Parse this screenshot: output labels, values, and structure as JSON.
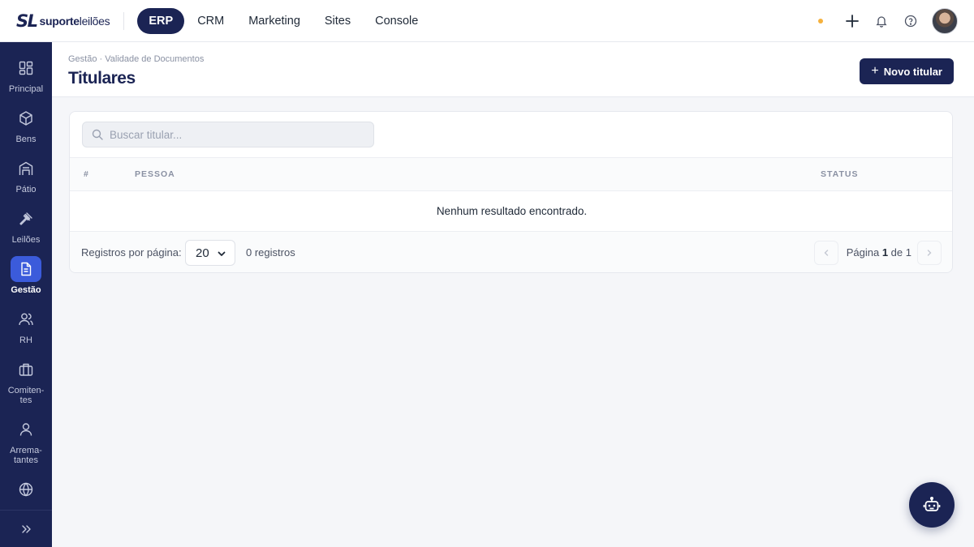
{
  "brand": {
    "mark": "SL",
    "name_bold": "suporte",
    "name_light": "leilões"
  },
  "nav": {
    "items": [
      {
        "label": "ERP",
        "active": true
      },
      {
        "label": "CRM",
        "active": false
      },
      {
        "label": "Marketing",
        "active": false
      },
      {
        "label": "Sites",
        "active": false
      },
      {
        "label": "Console",
        "active": false
      }
    ]
  },
  "top_actions": {
    "status_dot_color": "#f5b13d",
    "icons": [
      "plus-icon",
      "bell-icon",
      "help-icon"
    ]
  },
  "sidebar": {
    "items": [
      {
        "label": "Principal",
        "icon": "grid-icon",
        "active": false
      },
      {
        "label": "Bens",
        "icon": "box-icon",
        "active": false
      },
      {
        "label": "Pátio",
        "icon": "building-icon",
        "active": false
      },
      {
        "label": "Leilões",
        "icon": "gavel-icon",
        "active": false
      },
      {
        "label": "Gestão",
        "icon": "document-icon",
        "active": true
      },
      {
        "label": "RH",
        "icon": "users-icon",
        "active": false
      },
      {
        "label": "Comiten-\ntes",
        "icon": "briefcase-icon",
        "active": false
      },
      {
        "label": "Arrema-\ntantes",
        "icon": "user-icon",
        "active": false
      },
      {
        "label": "",
        "icon": "globe-icon",
        "active": false
      }
    ]
  },
  "header": {
    "breadcrumb": "Gestão · Validade de Documentos",
    "title": "Titulares",
    "new_button_label": "Novo titular"
  },
  "search": {
    "placeholder": "Buscar titular...",
    "value": ""
  },
  "table": {
    "columns": [
      "#",
      "PESSOA",
      "STATUS"
    ],
    "rows": [],
    "empty_message": "Nenhum resultado encontrado."
  },
  "pagination": {
    "per_page_label": "Registros por página:",
    "per_page_value": "20",
    "records_text": "0 registros",
    "page_prefix": "Página",
    "current_page": "1",
    "page_of": "de",
    "total_pages": "1"
  },
  "colors": {
    "primary": "#1b2454",
    "accent": "#3b5bdb"
  }
}
